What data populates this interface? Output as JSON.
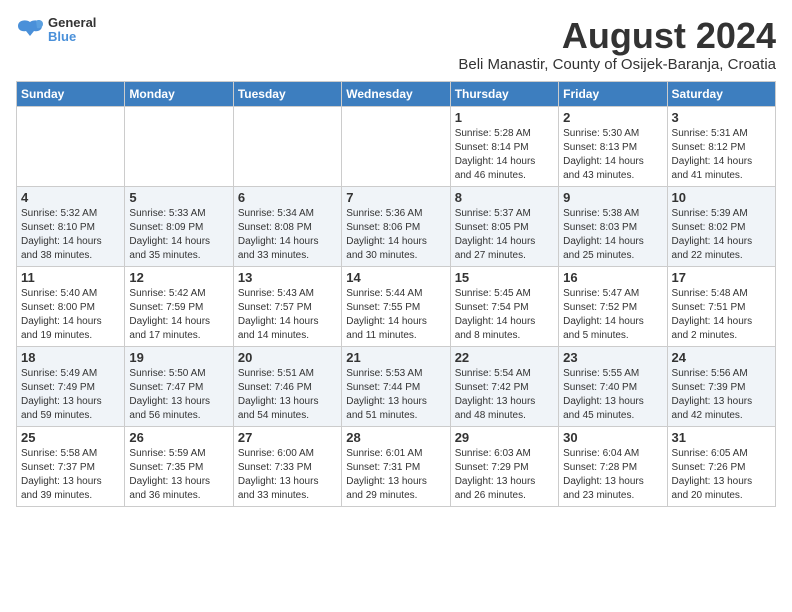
{
  "logo": {
    "line1": "General",
    "line2": "Blue"
  },
  "title": "August 2024",
  "subtitle": "Beli Manastir, County of Osijek-Baranja, Croatia",
  "headers": [
    "Sunday",
    "Monday",
    "Tuesday",
    "Wednesday",
    "Thursday",
    "Friday",
    "Saturday"
  ],
  "weeks": [
    [
      {
        "day": "",
        "sunrise": "",
        "sunset": "",
        "daylight": ""
      },
      {
        "day": "",
        "sunrise": "",
        "sunset": "",
        "daylight": ""
      },
      {
        "day": "",
        "sunrise": "",
        "sunset": "",
        "daylight": ""
      },
      {
        "day": "",
        "sunrise": "",
        "sunset": "",
        "daylight": ""
      },
      {
        "day": "1",
        "sunrise": "Sunrise: 5:28 AM",
        "sunset": "Sunset: 8:14 PM",
        "daylight": "Daylight: 14 hours and 46 minutes."
      },
      {
        "day": "2",
        "sunrise": "Sunrise: 5:30 AM",
        "sunset": "Sunset: 8:13 PM",
        "daylight": "Daylight: 14 hours and 43 minutes."
      },
      {
        "day": "3",
        "sunrise": "Sunrise: 5:31 AM",
        "sunset": "Sunset: 8:12 PM",
        "daylight": "Daylight: 14 hours and 41 minutes."
      }
    ],
    [
      {
        "day": "4",
        "sunrise": "Sunrise: 5:32 AM",
        "sunset": "Sunset: 8:10 PM",
        "daylight": "Daylight: 14 hours and 38 minutes."
      },
      {
        "day": "5",
        "sunrise": "Sunrise: 5:33 AM",
        "sunset": "Sunset: 8:09 PM",
        "daylight": "Daylight: 14 hours and 35 minutes."
      },
      {
        "day": "6",
        "sunrise": "Sunrise: 5:34 AM",
        "sunset": "Sunset: 8:08 PM",
        "daylight": "Daylight: 14 hours and 33 minutes."
      },
      {
        "day": "7",
        "sunrise": "Sunrise: 5:36 AM",
        "sunset": "Sunset: 8:06 PM",
        "daylight": "Daylight: 14 hours and 30 minutes."
      },
      {
        "day": "8",
        "sunrise": "Sunrise: 5:37 AM",
        "sunset": "Sunset: 8:05 PM",
        "daylight": "Daylight: 14 hours and 27 minutes."
      },
      {
        "day": "9",
        "sunrise": "Sunrise: 5:38 AM",
        "sunset": "Sunset: 8:03 PM",
        "daylight": "Daylight: 14 hours and 25 minutes."
      },
      {
        "day": "10",
        "sunrise": "Sunrise: 5:39 AM",
        "sunset": "Sunset: 8:02 PM",
        "daylight": "Daylight: 14 hours and 22 minutes."
      }
    ],
    [
      {
        "day": "11",
        "sunrise": "Sunrise: 5:40 AM",
        "sunset": "Sunset: 8:00 PM",
        "daylight": "Daylight: 14 hours and 19 minutes."
      },
      {
        "day": "12",
        "sunrise": "Sunrise: 5:42 AM",
        "sunset": "Sunset: 7:59 PM",
        "daylight": "Daylight: 14 hours and 17 minutes."
      },
      {
        "day": "13",
        "sunrise": "Sunrise: 5:43 AM",
        "sunset": "Sunset: 7:57 PM",
        "daylight": "Daylight: 14 hours and 14 minutes."
      },
      {
        "day": "14",
        "sunrise": "Sunrise: 5:44 AM",
        "sunset": "Sunset: 7:55 PM",
        "daylight": "Daylight: 14 hours and 11 minutes."
      },
      {
        "day": "15",
        "sunrise": "Sunrise: 5:45 AM",
        "sunset": "Sunset: 7:54 PM",
        "daylight": "Daylight: 14 hours and 8 minutes."
      },
      {
        "day": "16",
        "sunrise": "Sunrise: 5:47 AM",
        "sunset": "Sunset: 7:52 PM",
        "daylight": "Daylight: 14 hours and 5 minutes."
      },
      {
        "day": "17",
        "sunrise": "Sunrise: 5:48 AM",
        "sunset": "Sunset: 7:51 PM",
        "daylight": "Daylight: 14 hours and 2 minutes."
      }
    ],
    [
      {
        "day": "18",
        "sunrise": "Sunrise: 5:49 AM",
        "sunset": "Sunset: 7:49 PM",
        "daylight": "Daylight: 13 hours and 59 minutes."
      },
      {
        "day": "19",
        "sunrise": "Sunrise: 5:50 AM",
        "sunset": "Sunset: 7:47 PM",
        "daylight": "Daylight: 13 hours and 56 minutes."
      },
      {
        "day": "20",
        "sunrise": "Sunrise: 5:51 AM",
        "sunset": "Sunset: 7:46 PM",
        "daylight": "Daylight: 13 hours and 54 minutes."
      },
      {
        "day": "21",
        "sunrise": "Sunrise: 5:53 AM",
        "sunset": "Sunset: 7:44 PM",
        "daylight": "Daylight: 13 hours and 51 minutes."
      },
      {
        "day": "22",
        "sunrise": "Sunrise: 5:54 AM",
        "sunset": "Sunset: 7:42 PM",
        "daylight": "Daylight: 13 hours and 48 minutes."
      },
      {
        "day": "23",
        "sunrise": "Sunrise: 5:55 AM",
        "sunset": "Sunset: 7:40 PM",
        "daylight": "Daylight: 13 hours and 45 minutes."
      },
      {
        "day": "24",
        "sunrise": "Sunrise: 5:56 AM",
        "sunset": "Sunset: 7:39 PM",
        "daylight": "Daylight: 13 hours and 42 minutes."
      }
    ],
    [
      {
        "day": "25",
        "sunrise": "Sunrise: 5:58 AM",
        "sunset": "Sunset: 7:37 PM",
        "daylight": "Daylight: 13 hours and 39 minutes."
      },
      {
        "day": "26",
        "sunrise": "Sunrise: 5:59 AM",
        "sunset": "Sunset: 7:35 PM",
        "daylight": "Daylight: 13 hours and 36 minutes."
      },
      {
        "day": "27",
        "sunrise": "Sunrise: 6:00 AM",
        "sunset": "Sunset: 7:33 PM",
        "daylight": "Daylight: 13 hours and 33 minutes."
      },
      {
        "day": "28",
        "sunrise": "Sunrise: 6:01 AM",
        "sunset": "Sunset: 7:31 PM",
        "daylight": "Daylight: 13 hours and 29 minutes."
      },
      {
        "day": "29",
        "sunrise": "Sunrise: 6:03 AM",
        "sunset": "Sunset: 7:29 PM",
        "daylight": "Daylight: 13 hours and 26 minutes."
      },
      {
        "day": "30",
        "sunrise": "Sunrise: 6:04 AM",
        "sunset": "Sunset: 7:28 PM",
        "daylight": "Daylight: 13 hours and 23 minutes."
      },
      {
        "day": "31",
        "sunrise": "Sunrise: 6:05 AM",
        "sunset": "Sunset: 7:26 PM",
        "daylight": "Daylight: 13 hours and 20 minutes."
      }
    ]
  ]
}
